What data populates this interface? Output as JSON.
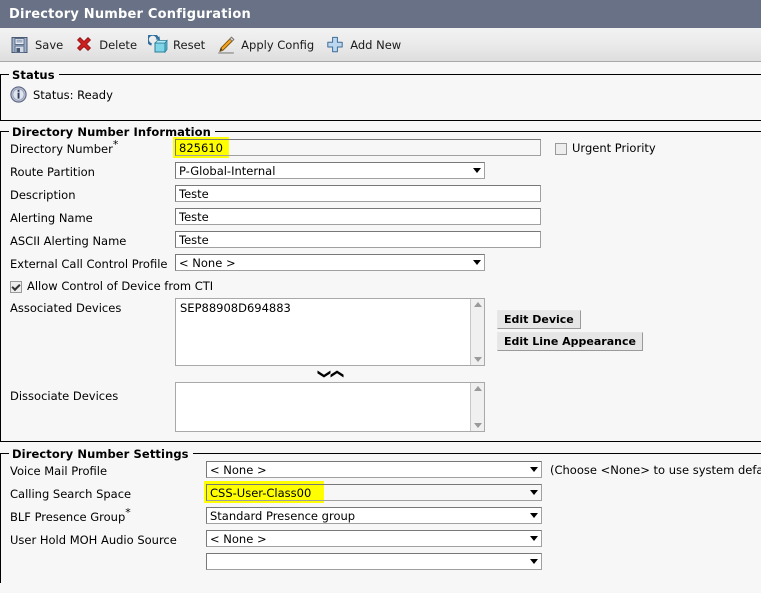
{
  "window": {
    "title": "Directory Number Configuration"
  },
  "toolbar": {
    "buttons": [
      {
        "label": "Save",
        "icon": "save-icon"
      },
      {
        "label": "Delete",
        "icon": "delete-icon"
      },
      {
        "label": "Reset",
        "icon": "reset-icon"
      },
      {
        "label": "Apply Config",
        "icon": "apply-config-icon"
      },
      {
        "label": "Add New",
        "icon": "add-new-icon"
      }
    ]
  },
  "status_section": {
    "legend": "Status",
    "icon": "info-icon",
    "text": "Status: Ready"
  },
  "dn_information": {
    "legend": "Directory Number Information",
    "fields": {
      "directory_number": {
        "label": "Directory Number",
        "required": true,
        "value": "825610",
        "highlighted": true
      },
      "route_partition": {
        "label": "Route Partition",
        "value": "P-Global-Internal"
      },
      "description": {
        "label": "Description",
        "value": "Teste"
      },
      "alerting_name": {
        "label": "Alerting Name",
        "value": "Teste"
      },
      "ascii_alerting_name": {
        "label": "ASCII Alerting Name",
        "value": "Teste"
      },
      "external_call_control_profile": {
        "label": "External Call Control Profile",
        "value": "< None >"
      }
    },
    "urgent_priority": {
      "label": "Urgent Priority",
      "checked": false
    },
    "allow_control_cti": {
      "label": "Allow Control of Device from CTI",
      "checked": true
    },
    "associated_devices": {
      "label": "Associated Devices",
      "items": [
        "SEP88908D694883"
      ]
    },
    "dissociate_devices": {
      "label": "Dissociate Devices",
      "items": []
    },
    "move_down_glyph": "❯",
    "move_up_glyph": "❯",
    "side_buttons": [
      {
        "label": "Edit Device"
      },
      {
        "label": "Edit Line Appearance"
      }
    ]
  },
  "dn_settings": {
    "legend": "Directory Number Settings",
    "fields": {
      "voice_mail_profile": {
        "label": "Voice Mail Profile",
        "value": "< None >",
        "hint": "(Choose <None> to use system default)"
      },
      "calling_search_space": {
        "label": "Calling Search Space",
        "value": "CSS-User-Class00",
        "highlighted": true
      },
      "blf_presence_group": {
        "label": "BLF Presence Group",
        "required": true,
        "value": "Standard Presence group"
      },
      "user_hold_moh_audio_source": {
        "label": "User Hold MOH Audio Source",
        "value": "< None >"
      },
      "partial_row": {
        "label": "",
        "value": ""
      }
    }
  },
  "colors": {
    "titlebar_bg": "#687186",
    "highlight": "#ffff00",
    "page_bg": "#f7f7f7"
  }
}
